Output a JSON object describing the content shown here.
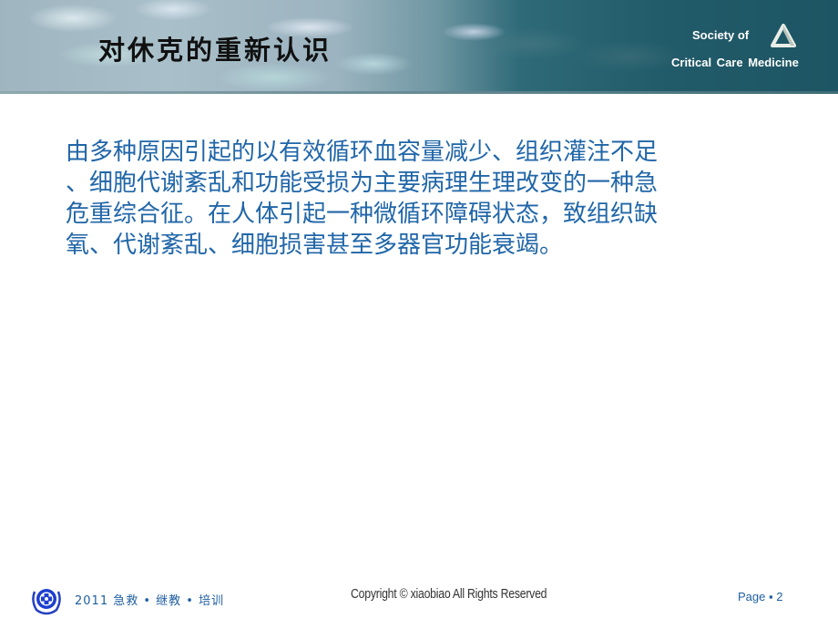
{
  "header": {
    "title": "对休克的重新认识",
    "society_line1": "Society of",
    "society_line2": "Critical Care Medicine",
    "logo_icon": "triangle-logo-icon"
  },
  "content": {
    "lines": [
      "由多种原因引起的以有效循环血容量减少、组织灌注不足",
      "、细胞代谢紊乱和功能受损为主要病理生理改变的一种急",
      "危重综合征。在人体引起一种微循环障碍状态，致组织缺",
      "氧、代谢紊乱、细胞损害甚至多器官功能衰竭。"
    ],
    "text_color": "#2066a8"
  },
  "footer": {
    "emblem_icon": "medical-cross-emblem-icon",
    "left_text": "2011 急救 • 继教 • 培训",
    "copyright": "Copyright © xiaobiao All Rights Reserved",
    "page_label": "Page ▪ 2"
  }
}
